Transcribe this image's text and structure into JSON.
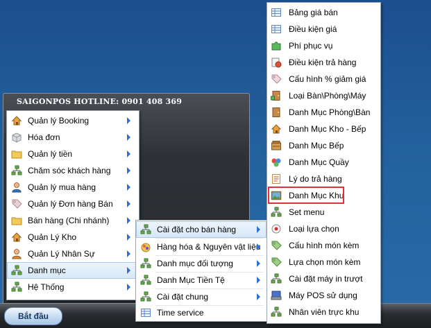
{
  "hotline": "SAIGONPOS HOTLINE: 0901 408 369",
  "start_button": "Bắt đầu",
  "main_menu": [
    {
      "label": "Quản lý Booking",
      "icon": "house-icon"
    },
    {
      "label": "Hóa đơn",
      "icon": "box-icon"
    },
    {
      "label": "Quản lý tiền",
      "icon": "folder-icon"
    },
    {
      "label": "Chăm sóc khách hàng",
      "icon": "network-icon"
    },
    {
      "label": "Quản lý mua hàng",
      "icon": "user-icon"
    },
    {
      "label": "Quản lý Đơn hàng Bán",
      "icon": "tag-icon"
    },
    {
      "label": "Bán hàng (Chi nhánh)",
      "icon": "folder-icon"
    },
    {
      "label": "Quản Lý Kho",
      "icon": "house-icon"
    },
    {
      "label": "Quản Lý Nhân Sự",
      "icon": "user-icon"
    },
    {
      "label": "Danh mục",
      "icon": "network-icon"
    },
    {
      "label": "Hệ Thống",
      "icon": "network-icon"
    }
  ],
  "submenu_danh_muc": [
    {
      "label": "Cài đặt cho bán hàng",
      "icon": "network-icon"
    },
    {
      "label": "Hàng hóa & Nguyên vật liệu",
      "icon": "goods-icon"
    },
    {
      "label": "Danh mục đối tượng",
      "icon": "network-icon"
    },
    {
      "label": "Danh Mục Tiền Tệ",
      "icon": "network-icon"
    },
    {
      "label": "Cài đặt chung",
      "icon": "network-icon"
    },
    {
      "label": "Time service",
      "icon": "table-icon"
    }
  ],
  "submenu_cai_dat_ban_hang": [
    {
      "label": "Bảng giá bán",
      "icon": "table-icon"
    },
    {
      "label": "Điều kiện giá",
      "icon": "table-icon"
    },
    {
      "label": "Phí phục vụ",
      "icon": "puzzle-icon"
    },
    {
      "label": "Điều kiện trả hàng",
      "icon": "return-icon"
    },
    {
      "label": "Cấu hình % giảm giá",
      "icon": "tag-icon"
    },
    {
      "label": "Loại Bàn\\Phòng\\Máy",
      "icon": "door-icon"
    },
    {
      "label": "Danh Mục Phòng\\Bàn",
      "icon": "door-icon"
    },
    {
      "label": "Danh Mục Kho - Bếp",
      "icon": "house-icon"
    },
    {
      "label": "Danh Mục Bếp",
      "icon": "stove-icon"
    },
    {
      "label": "Danh Mục Quầy",
      "icon": "counter-icon"
    },
    {
      "label": "Lý do trả hàng",
      "icon": "list-icon"
    },
    {
      "label": "Danh Mục Khu",
      "icon": "picture-icon"
    },
    {
      "label": "Set menu",
      "icon": "network-icon"
    },
    {
      "label": "Loại lựa chọn",
      "icon": "radio-icon"
    },
    {
      "label": "Cấu hình món kèm",
      "icon": "tag-icon"
    },
    {
      "label": "Lựa chọn món kèm",
      "icon": "tag-icon"
    },
    {
      "label": "Cài đặt máy in trượt",
      "icon": "network-icon"
    },
    {
      "label": "Máy POS sử dụng",
      "icon": "pos-icon"
    },
    {
      "label": "Nhân viên trực khu",
      "icon": "network-icon"
    }
  ],
  "highlighted": {
    "main": "Danh mục",
    "sub": "Cài đặt cho bán hàng",
    "selected": "Danh Mục Khu"
  },
  "colors": {
    "arrow": "#2f6fd0",
    "selection_box": "#e0313a",
    "highlight": "#d6e7f8"
  }
}
